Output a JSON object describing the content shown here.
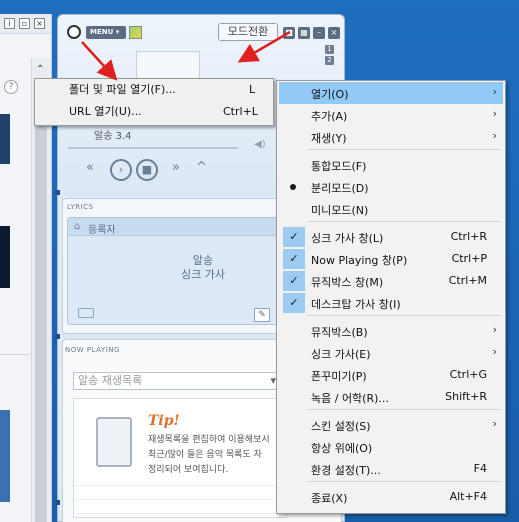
{
  "header": {
    "menu_label": "MENU",
    "mode_switch": "모드전환",
    "badges": [
      "1",
      "2"
    ]
  },
  "player": {
    "track": "알송 3.4"
  },
  "lyrics": {
    "section": "LYRICS",
    "register": "등록자",
    "line1": "알송",
    "line2": "싱크 가사"
  },
  "now_playing": {
    "section": "NOW PLAYING",
    "playlist_select": "알송 재생목록",
    "tip_title": "Tip!",
    "tip_line1": "재생목록을 편집하여 이용해보시",
    "tip_line2": "최근/많이 들은 음악 목록도 자",
    "tip_line3": "정리되어 보여집니다."
  },
  "file_menu": {
    "items": [
      {
        "label": "폴더 및 파일 열기(F)...",
        "shortcut": "L"
      },
      {
        "label": "URL 열기(U)...",
        "shortcut": "Ctrl+L"
      }
    ]
  },
  "context_menu": {
    "items": [
      {
        "label": "열기(O)",
        "shortcut": "",
        "submenu": true,
        "highlighted": true
      },
      {
        "label": "추가(A)",
        "shortcut": "",
        "submenu": true
      },
      {
        "label": "재생(Y)",
        "shortcut": "",
        "submenu": true
      },
      {
        "label": "통합모드(F)",
        "shortcut": ""
      },
      {
        "label": "분리모드(D)",
        "shortcut": "",
        "radio": true
      },
      {
        "label": "미니모드(N)",
        "shortcut": ""
      },
      {
        "label": "싱크 가사 창(L)",
        "shortcut": "Ctrl+R",
        "checked": true
      },
      {
        "label": "Now Playing 창(P)",
        "shortcut": "Ctrl+P",
        "checked": true
      },
      {
        "label": "뮤직박스 창(M)",
        "shortcut": "Ctrl+M",
        "checked": true
      },
      {
        "label": "데스크탑 가사 창(I)",
        "shortcut": "",
        "checked": true
      },
      {
        "label": "뮤직박스(B)",
        "shortcut": "",
        "submenu": true
      },
      {
        "label": "싱크 가사(E)",
        "shortcut": "",
        "submenu": true
      },
      {
        "label": "폰꾸미기(P)",
        "shortcut": "Ctrl+G"
      },
      {
        "label": "녹음 / 어학(R)...",
        "shortcut": "Shift+R"
      },
      {
        "label": "스킨 설정(S)",
        "shortcut": "",
        "submenu": true
      },
      {
        "label": "항상 위에(O)",
        "shortcut": ""
      },
      {
        "label": "환경 설정(T)...",
        "shortcut": "F4"
      },
      {
        "label": "종료(X)",
        "shortcut": "Alt+F4"
      }
    ]
  },
  "colors": {
    "desktop": "#1e6fc0",
    "highlight": "#91c9f7",
    "arrow": "#e02020",
    "tip": "#e06f2a"
  }
}
